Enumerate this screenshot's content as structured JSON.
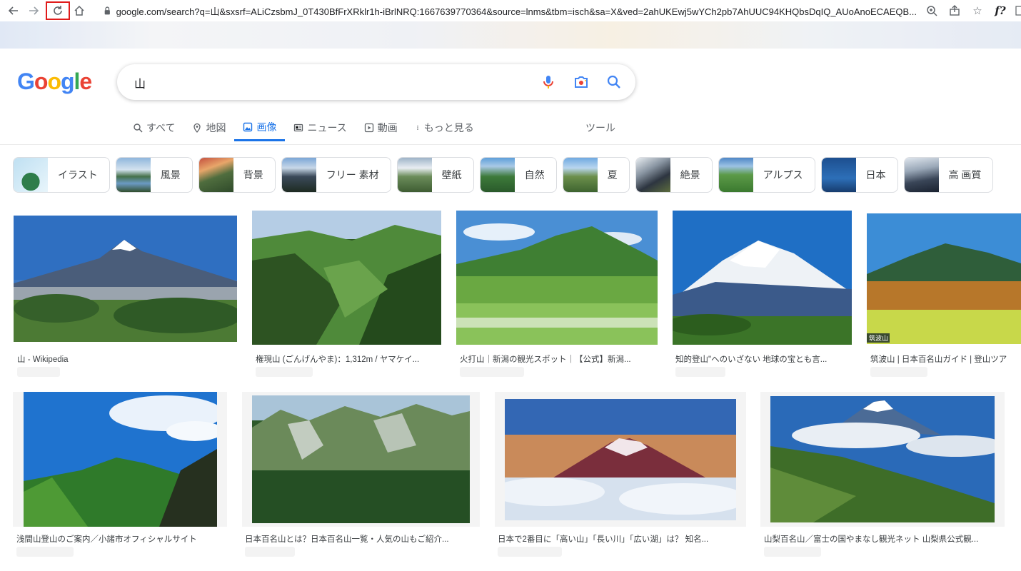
{
  "browser": {
    "url": "google.com/search?q=山&sxsrf=ALiCzsbmJ_0T430BfFrXRklr1h-iBrlNRQ:1667639770364&source=lnms&tbm=isch&sa=X&ved=2ahUKEwj5wYCh2pb7AhUUC94KHQbsDqIQ_AUoAnoECAEQB..."
  },
  "search": {
    "query": "山"
  },
  "tabs": [
    {
      "label": "すべて",
      "icon": "search-icon"
    },
    {
      "label": "地図",
      "icon": "map-pin-icon"
    },
    {
      "label": "画像",
      "icon": "image-icon",
      "active": true
    },
    {
      "label": "ニュース",
      "icon": "news-icon"
    },
    {
      "label": "動画",
      "icon": "video-icon"
    },
    {
      "label": "もっと見る",
      "icon": "more-vert-icon"
    }
  ],
  "tools_label": "ツール",
  "chips": [
    {
      "label": "イラスト"
    },
    {
      "label": "風景"
    },
    {
      "label": "背景"
    },
    {
      "label": "フリー 素材"
    },
    {
      "label": "壁紙"
    },
    {
      "label": "自然"
    },
    {
      "label": "夏"
    },
    {
      "label": "絶景"
    },
    {
      "label": "アルプス"
    },
    {
      "label": "日本"
    },
    {
      "label": "高 画質"
    }
  ],
  "results_row1": [
    {
      "caption": "山 - Wikipedia"
    },
    {
      "caption": "権現山 (ごんげんやま)：1,312m / ヤマケイ..."
    },
    {
      "caption": "火打山｜新潟の観光スポット｜【公式】新潟..."
    },
    {
      "caption": "知的登山\"へのいざない 地球の宝とも言..."
    },
    {
      "caption": "筑波山 | 日本百名山ガイド | 登山ツア"
    }
  ],
  "results_row2": [
    {
      "caption": "浅間山登山のご案内／小諸市オフィシャルサイト"
    },
    {
      "caption": "日本百名山とは？日本百名山一覧・人気の山もご紹介..."
    },
    {
      "caption": "日本で2番目に「高い山」「長い川」「広い湖」は？ 知名..."
    },
    {
      "caption": "山梨百名山／富士の国やまなし観光ネット 山梨県公式観..."
    }
  ],
  "colors": {
    "accent": "#1a73e8",
    "reload_highlight": "#e01b1b"
  }
}
